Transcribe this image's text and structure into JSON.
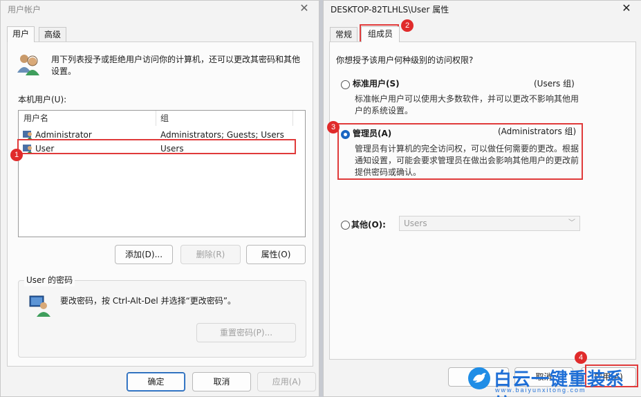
{
  "left_dialog": {
    "title": "用户帐户",
    "close_glyph": "✕",
    "tabs": [
      {
        "label": "用户"
      },
      {
        "label": "高级"
      }
    ],
    "intro_text_line1": "用下列表授予或拒绝用户访问你的计算机，还可以更改其密码和其他",
    "intro_text_line2": "设置。",
    "users_label": "本机用户(U):",
    "columns": [
      "用户名",
      "组"
    ],
    "users": [
      {
        "name": "Administrator",
        "group": "Administrators; Guests; Users"
      },
      {
        "name": "User",
        "group": "Users"
      }
    ],
    "buttons": {
      "add": "添加(D)...",
      "remove": "删除(R)",
      "properties": "属性(O)"
    },
    "password_group_title": "User 的密码",
    "password_text": "要改密码，按 Ctrl-Alt-Del 并选择“更改密码”。",
    "reset_password": "重置密码(P)...",
    "footer": {
      "ok": "确定",
      "cancel": "取消",
      "apply": "应用(A)"
    }
  },
  "right_dialog": {
    "title": "DESKTOP-82TLHLS\\User 属性",
    "close_glyph": "✕",
    "tabs": [
      {
        "label": "常规"
      },
      {
        "label": "组成员"
      }
    ],
    "question": "你想授予该用户何种级别的访问权限?",
    "options": [
      {
        "label": "标准用户(S)",
        "group": "(Users 组)",
        "desc1": "标准帐户用户可以使用大多数软件，并可以更改不影响其他用",
        "desc2": "户的系统设置。",
        "checked": false
      },
      {
        "label": "管理员(A)",
        "group": "(Administrators 组)",
        "desc1": "管理员有计算机的完全访问权，可以做任何需要的更改。根据",
        "desc2": "通知设置，可能会要求管理员在做出会影响其他用户的更改前",
        "desc3": "提供密码或确认。",
        "checked": true
      },
      {
        "label": "其他(O):",
        "checked": false
      }
    ],
    "other_select_value": "Users",
    "footer": {
      "cancel": "取消",
      "apply": "应用(A)"
    }
  },
  "annotations": [
    "1",
    "2",
    "3",
    "4"
  ],
  "watermark": {
    "text": "白云一键重装系统",
    "sub": "www.baiyunxitong.com"
  },
  "colors": {
    "accent_red": "#e03a3a",
    "radio_blue": "#1a66c2",
    "brand_blue": "#1f6fd6"
  }
}
